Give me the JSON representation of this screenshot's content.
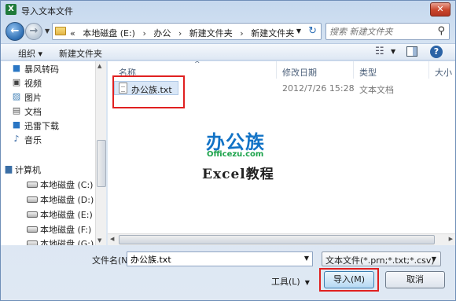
{
  "window": {
    "title": "导入文本文件",
    "app_icon": "X",
    "close_label": "✕"
  },
  "address": {
    "crumbs": [
      "«",
      "本地磁盘 (E:)",
      "›",
      "办公",
      "›",
      "新建文件夹",
      "›",
      "新建文件夹"
    ],
    "search_placeholder": "搜索 新建文件夹"
  },
  "toolbar": {
    "organize_label": "组织 ▾",
    "new_folder_label": "新建文件夹"
  },
  "nav": {
    "items": [
      {
        "label": "暴风转码",
        "icon": "video-folder-icon"
      },
      {
        "label": "视频",
        "icon": "video-icon"
      },
      {
        "label": "图片",
        "icon": "picture-icon"
      },
      {
        "label": "文档",
        "icon": "document-icon"
      },
      {
        "label": "迅雷下载",
        "icon": "download-icon"
      },
      {
        "label": "音乐",
        "icon": "music-icon"
      }
    ],
    "computer_label": "计算机",
    "drives": [
      "本地磁盘 (C:)",
      "本地磁盘 (D:)",
      "本地磁盘 (E:)",
      "本地磁盘 (F:)",
      "本地磁盘 (G:)"
    ],
    "selected_drive": "本地磁盘 (E:)"
  },
  "filelist": {
    "columns": [
      "名称",
      "修改日期",
      "类型",
      "大小"
    ],
    "rows": [
      {
        "name": "办公族.txt",
        "modified": "2012/7/26 15:28",
        "type": "文本文档"
      }
    ]
  },
  "watermark": {
    "brand": "办公族",
    "url": "Officezu.com",
    "tagline": "Excel教程"
  },
  "bottom": {
    "filename_label": "文件名(N):",
    "filename_value": "办公族.txt",
    "filetype_value": "文本文件(*.prn;*.txt;*.csv)",
    "tools_label": "工具(L)",
    "import_label": "导入(M)",
    "cancel_label": "取消"
  },
  "colors": {
    "highlight": "#e02020",
    "brand_blue": "#1273c6",
    "brand_green": "#1ca34b"
  }
}
